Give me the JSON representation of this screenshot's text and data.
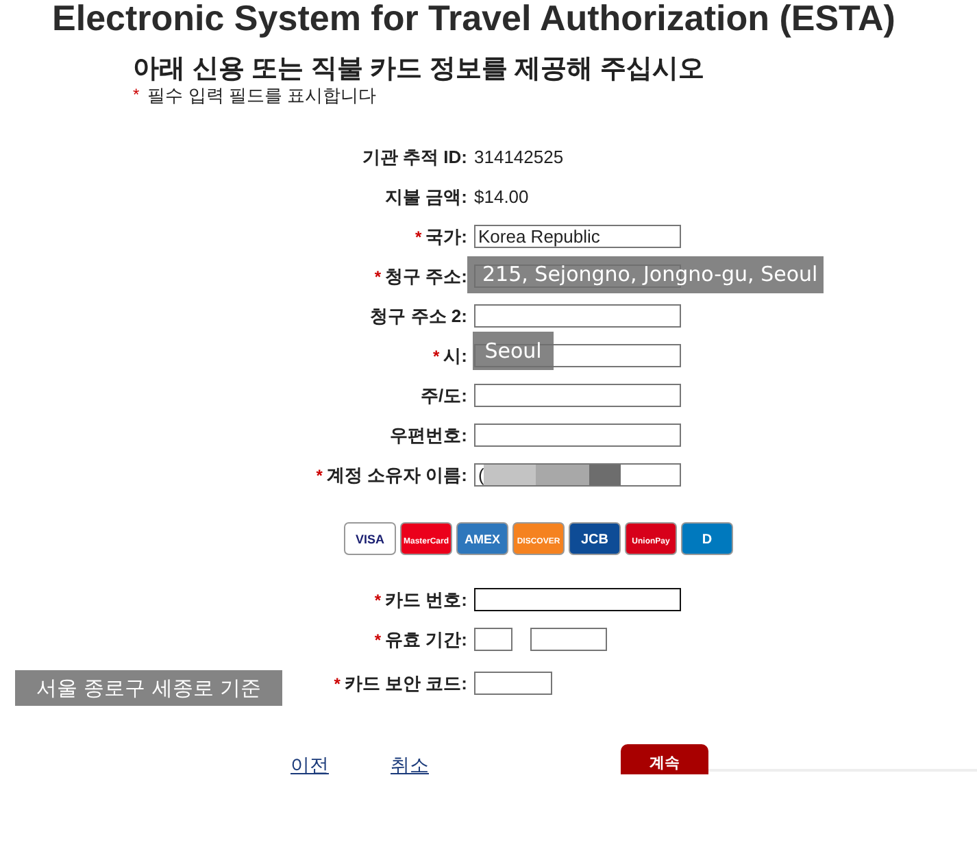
{
  "title": "Electronic System for Travel Authorization (ESTA)",
  "heading": "아래 신용 또는 직불 카드 정보를 제공해 주십시오",
  "required_mark": "*",
  "required_note": "필수 입력 필드를 표시합니다",
  "rows": [
    {
      "kind": "static",
      "label": "기관 추적 ID:",
      "required": false,
      "value": "314142525"
    },
    {
      "kind": "static",
      "label": "지불 금액:",
      "required": false,
      "value": "$14.00"
    },
    {
      "kind": "input",
      "label": "국가:",
      "required": true,
      "value": "Korea Republic",
      "focused": false,
      "redacted": false
    },
    {
      "kind": "input",
      "label": "청구 주소:",
      "required": true,
      "focused": false,
      "redacted": false
    },
    {
      "kind": "input",
      "label": "청구 주소 2:",
      "required": false,
      "focused": false,
      "redacted": false
    },
    {
      "kind": "input",
      "label": "시:",
      "required": true,
      "focused": false,
      "redacted": false
    },
    {
      "kind": "input",
      "label": "주/도:",
      "required": false,
      "focused": false,
      "redacted": false
    },
    {
      "kind": "input",
      "label": "우편번호:",
      "required": false,
      "focused": false,
      "redacted": false
    },
    {
      "kind": "input",
      "label": "계정 소유자 이름:",
      "required": true,
      "value": "(",
      "focused": false,
      "redacted": true
    },
    {
      "kind": "logos",
      "logos": [
        "VISA",
        "MasterCard",
        "AMEX",
        "DISCOVER",
        "JCB",
        "UnionPay",
        "D"
      ]
    },
    {
      "kind": "input",
      "label": "카드 번호:",
      "required": true,
      "focused": true,
      "redacted": false
    },
    {
      "kind": "date",
      "label": "유효 기간:",
      "required": true
    },
    {
      "kind": "small",
      "label": "카드 보안 코드:",
      "required": true
    }
  ],
  "links": [
    "이전",
    "취소"
  ],
  "continue_button": "계속",
  "captions": [
    "215, Sejongno, Jongno-gu, Seoul",
    "Seoul",
    "서울 종로구 세종로 기준"
  ]
}
